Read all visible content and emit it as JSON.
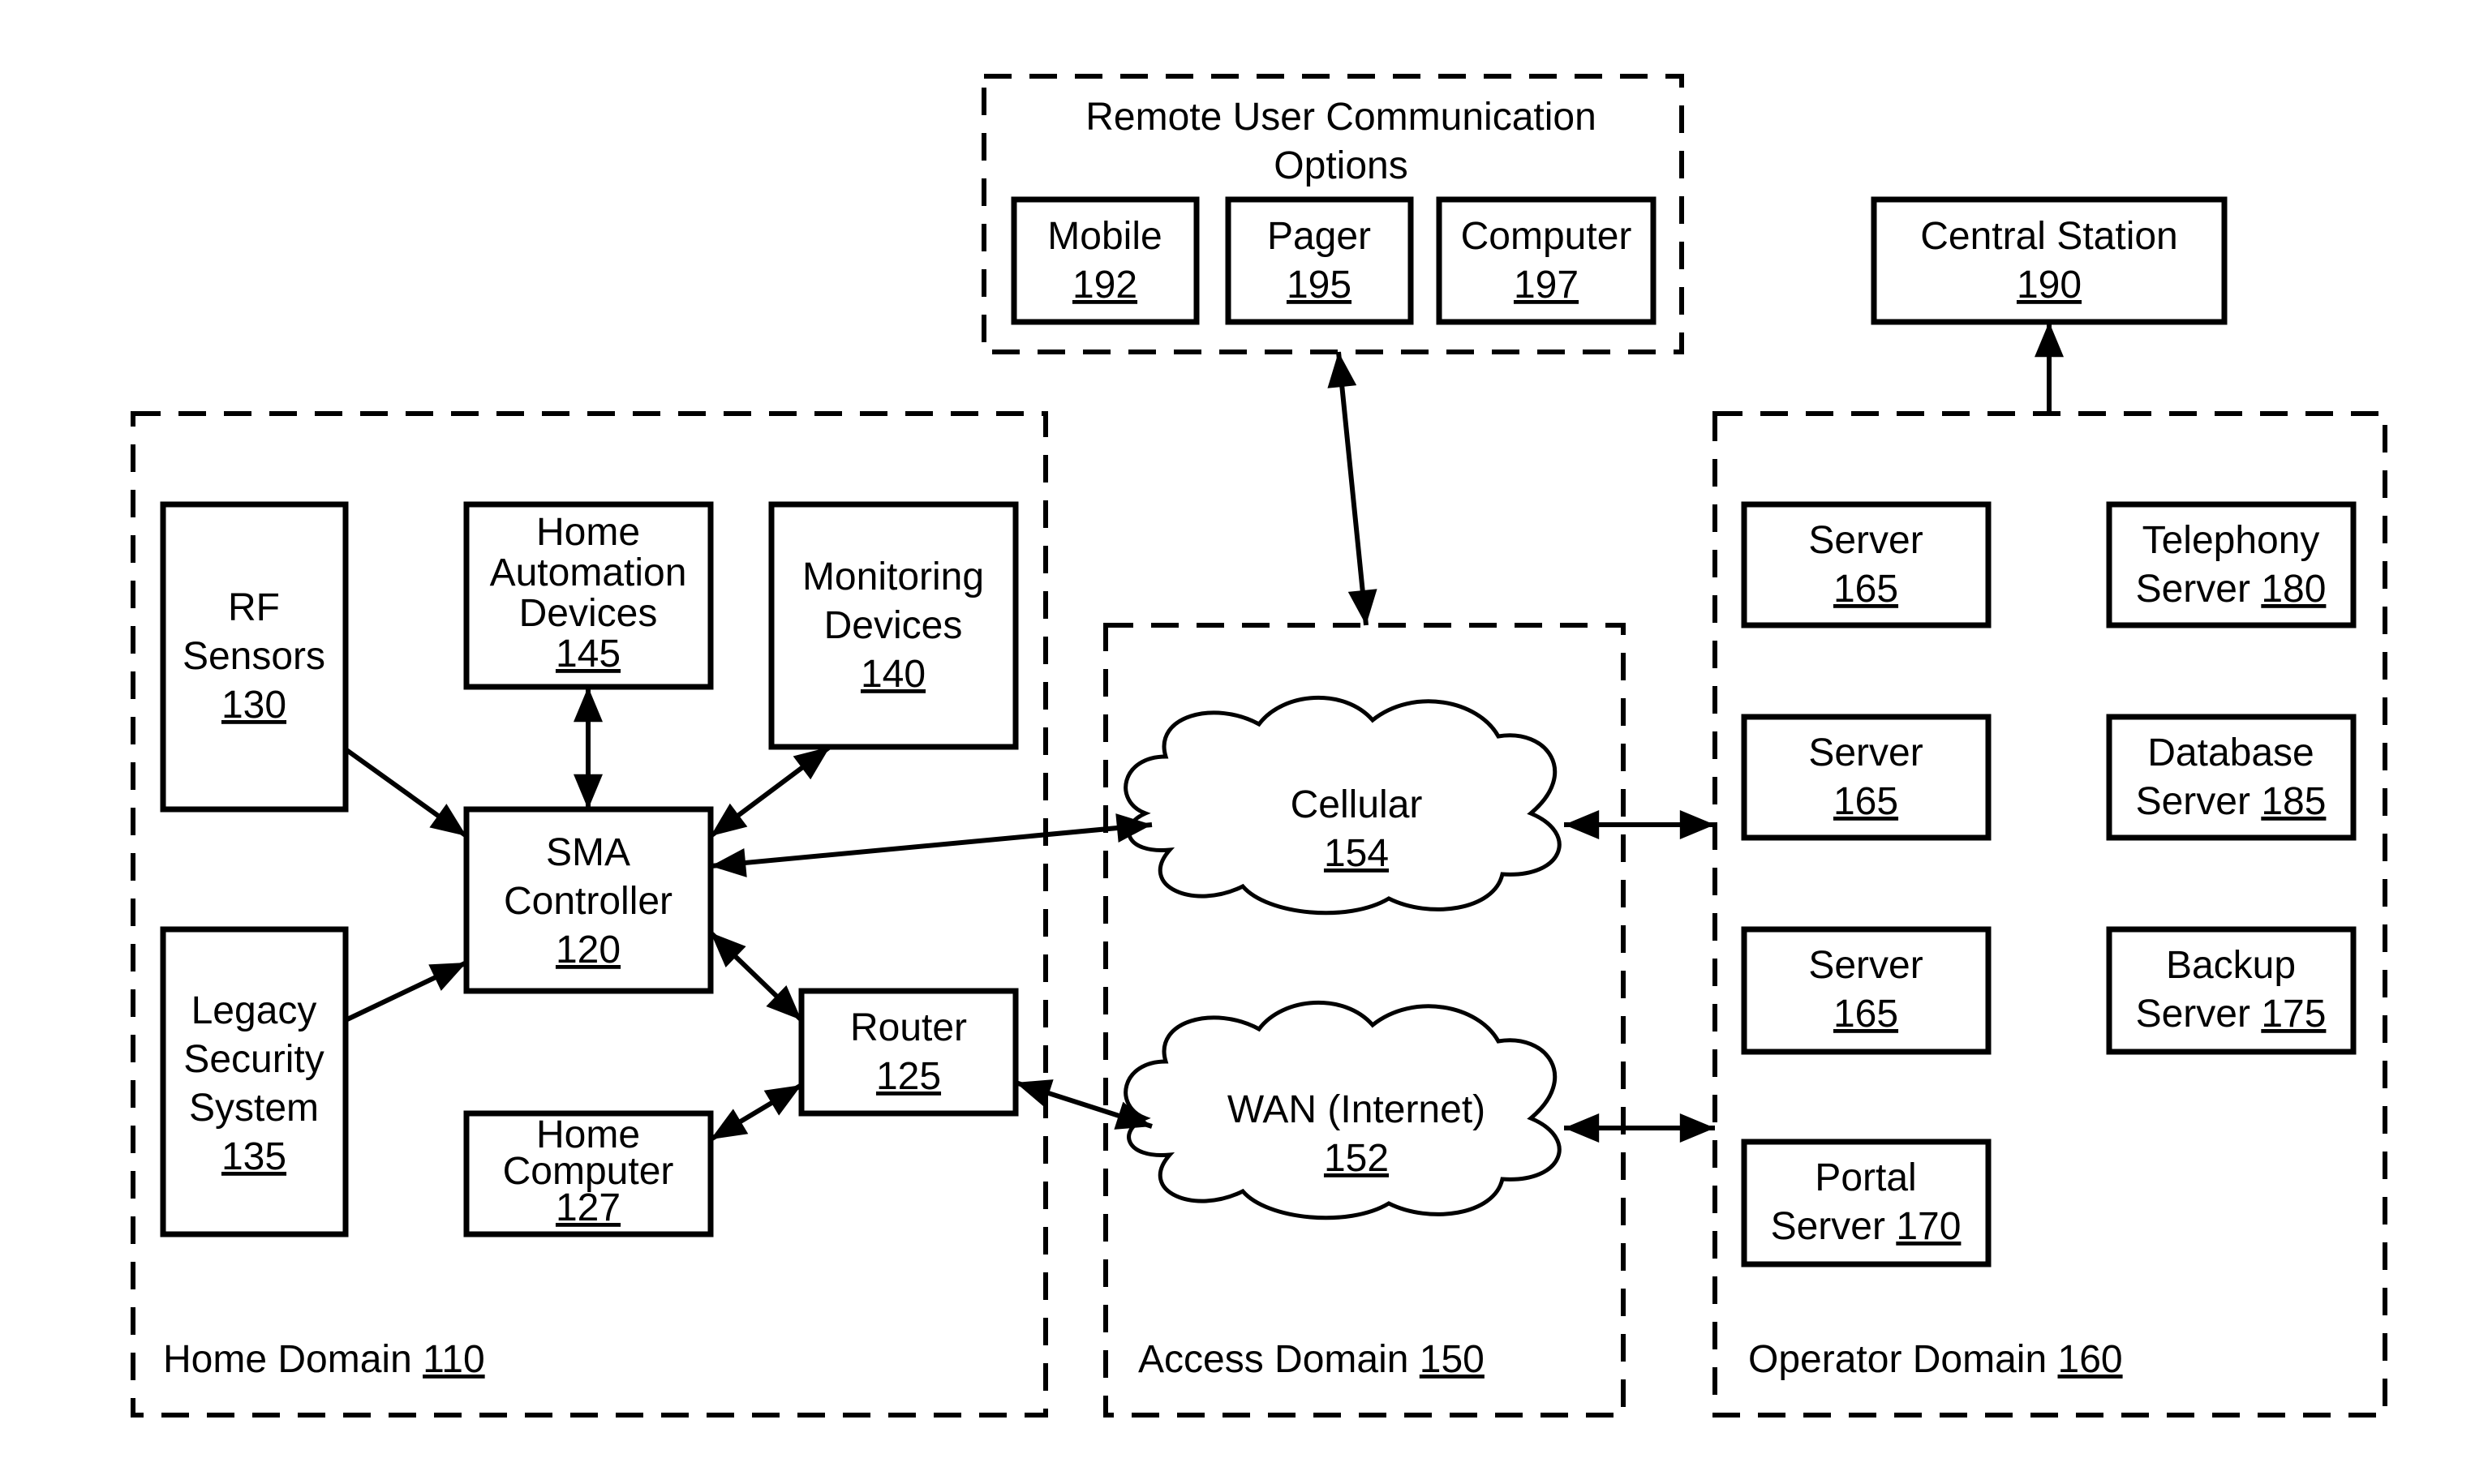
{
  "diagram": {
    "remote_options": {
      "title_line1": "Remote User Communication",
      "title_line2": "Options",
      "items": [
        {
          "label": "Mobile",
          "ref": "192"
        },
        {
          "label": "Pager",
          "ref": "195"
        },
        {
          "label": "Computer",
          "ref": "197"
        }
      ]
    },
    "central_station": {
      "label": "Central Station",
      "ref": "190"
    },
    "home_domain": {
      "label": "Home Domain ",
      "ref": "110",
      "rf_sensors": {
        "line1": "RF",
        "line2": "Sensors",
        "ref": "130"
      },
      "home_automation": {
        "line1": "Home",
        "line2": "Automation",
        "line3": "Devices",
        "ref": "145"
      },
      "monitoring": {
        "line1": "Monitoring",
        "line2": "Devices",
        "ref": "140"
      },
      "sma_controller": {
        "line1": "SMA",
        "line2": "Controller",
        "ref": "120"
      },
      "legacy_security": {
        "line1": "Legacy",
        "line2": "Security",
        "line3": "System",
        "ref": "135"
      },
      "router": {
        "line1": "Router",
        "ref": "125"
      },
      "home_computer": {
        "line1": "Home",
        "line2": "Computer",
        "ref": "127"
      }
    },
    "access_domain": {
      "label": "Access Domain ",
      "ref": "150",
      "cellular": {
        "label": "Cellular",
        "ref": "154"
      },
      "wan": {
        "label": "WAN (Internet)",
        "ref": "152"
      }
    },
    "operator_domain": {
      "label": "Operator Domain ",
      "ref": "160",
      "servers": [
        {
          "line1": "Server",
          "line2": "",
          "ref": "165"
        },
        {
          "line1": "Telephony",
          "line2": "Server ",
          "ref": "180"
        },
        {
          "line1": "Server",
          "line2": "",
          "ref": "165"
        },
        {
          "line1": "Database",
          "line2": "Server ",
          "ref": "185"
        },
        {
          "line1": "Server",
          "line2": "",
          "ref": "165"
        },
        {
          "line1": "Backup",
          "line2": "Server ",
          "ref": "175"
        },
        {
          "line1": "Portal",
          "line2": "Server ",
          "ref": "170"
        }
      ]
    }
  }
}
